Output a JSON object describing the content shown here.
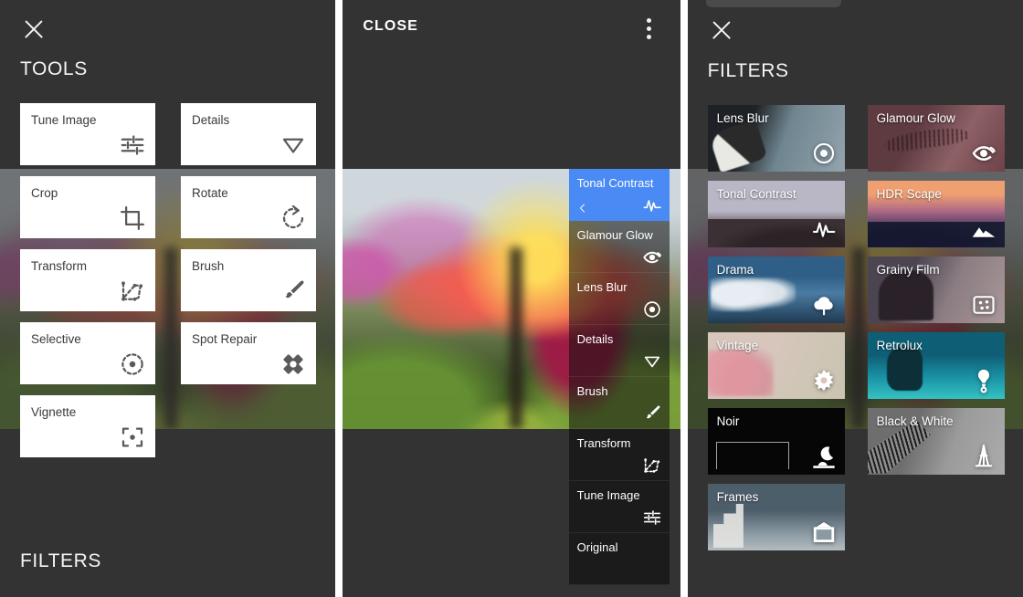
{
  "app": {
    "accent_blue": "#4a8af4",
    "dark_bg": "#333333",
    "card_white": "#ffffff"
  },
  "panel_tools": {
    "close_icon": "close-icon",
    "title": "TOOLS",
    "footer_title": "FILTERS",
    "tools": [
      {
        "label": "Tune Image",
        "icon": "sliders-icon"
      },
      {
        "label": "Details",
        "icon": "triangle-down-icon"
      },
      {
        "label": "Crop",
        "icon": "crop-icon"
      },
      {
        "label": "Rotate",
        "icon": "rotate-icon"
      },
      {
        "label": "Transform",
        "icon": "transform-icon"
      },
      {
        "label": "Brush",
        "icon": "brush-icon"
      },
      {
        "label": "Selective",
        "icon": "selective-target-icon"
      },
      {
        "label": "Spot Repair",
        "icon": "bandage-icon"
      },
      {
        "label": "Vignette",
        "icon": "vignette-icon"
      }
    ]
  },
  "panel_editor": {
    "close_label": "CLOSE",
    "overflow_icon": "three-dots-vertical-icon",
    "photo_alt": "blurred lady slipper orchid photo",
    "strip": [
      {
        "label": "Tonal Contrast",
        "icon": "waveform-icon",
        "selected": true,
        "chevron": "chevron-left-icon"
      },
      {
        "label": "Glamour Glow",
        "icon": "eye-icon",
        "selected": false
      },
      {
        "label": "Lens Blur",
        "icon": "lens-dot-icon",
        "selected": false
      },
      {
        "label": "Details",
        "icon": "triangle-down-icon",
        "selected": false
      },
      {
        "label": "Brush",
        "icon": "brush-icon",
        "selected": false
      },
      {
        "label": "Transform",
        "icon": "transform-icon",
        "selected": false
      },
      {
        "label": "Tune Image",
        "icon": "sliders-icon",
        "selected": false
      },
      {
        "label": "Original",
        "icon": "none",
        "selected": false
      }
    ]
  },
  "panel_filters": {
    "close_icon": "close-icon",
    "title": "FILTERS",
    "filters": [
      {
        "label": "Lens Blur",
        "icon": "lens-dot-icon",
        "thumb": "th-lensblur"
      },
      {
        "label": "Glamour Glow",
        "icon": "eye-icon",
        "thumb": "th-glamour"
      },
      {
        "label": "Tonal Contrast",
        "icon": "waveform-icon",
        "thumb": "th-tonal"
      },
      {
        "label": "HDR Scape",
        "icon": "mountains-icon",
        "thumb": "th-hdr"
      },
      {
        "label": "Drama",
        "icon": "cloud-icon",
        "thumb": "th-drama"
      },
      {
        "label": "Grainy Film",
        "icon": "grain-square-icon",
        "thumb": "th-grainy"
      },
      {
        "label": "Vintage",
        "icon": "gear-flower-icon",
        "thumb": "th-vintage"
      },
      {
        "label": "Retrolux",
        "icon": "bulb-icon",
        "thumb": "th-retrolux"
      },
      {
        "label": "Noir",
        "icon": "moon-icon",
        "thumb": "th-noir"
      },
      {
        "label": "Black & White",
        "icon": "eiffel-icon",
        "thumb": "th-bw"
      },
      {
        "label": "Frames",
        "icon": "frame-icon",
        "thumb": "th-frames"
      }
    ]
  }
}
